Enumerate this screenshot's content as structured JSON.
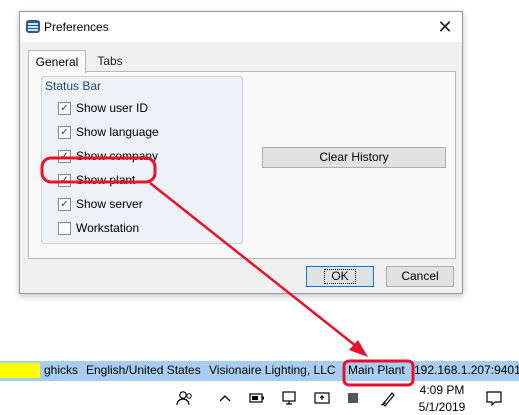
{
  "dialog": {
    "title": "Preferences",
    "close_glyph": "✕",
    "tabs": [
      {
        "label": "General",
        "active": true
      },
      {
        "label": "Tabs",
        "active": false
      }
    ],
    "status_bar_group": {
      "title": "Status Bar",
      "options": [
        {
          "label": "Show user ID",
          "checked": true
        },
        {
          "label": "Show language",
          "checked": true
        },
        {
          "label": "Show company",
          "checked": true
        },
        {
          "label": "Show plant",
          "checked": true
        },
        {
          "label": "Show server",
          "checked": true
        },
        {
          "label": "Workstation",
          "checked": false
        }
      ]
    },
    "clear_history_label": "Clear History",
    "ok_label": "OK",
    "cancel_label": "Cancel"
  },
  "status_bar": {
    "user": "ghicks",
    "language": "English/United States",
    "company": "Visionaire Lighting, LLC",
    "plant": "Main Plant",
    "server": "192.168.1.207:9401"
  },
  "taskbar": {
    "time": "4:09 PM",
    "date": "5/1/2019"
  },
  "colors": {
    "annotation": "#e8112d",
    "status_bar": "#a9cdf0",
    "status_indicator": "#ffff00",
    "group_title": "#1f497d"
  }
}
